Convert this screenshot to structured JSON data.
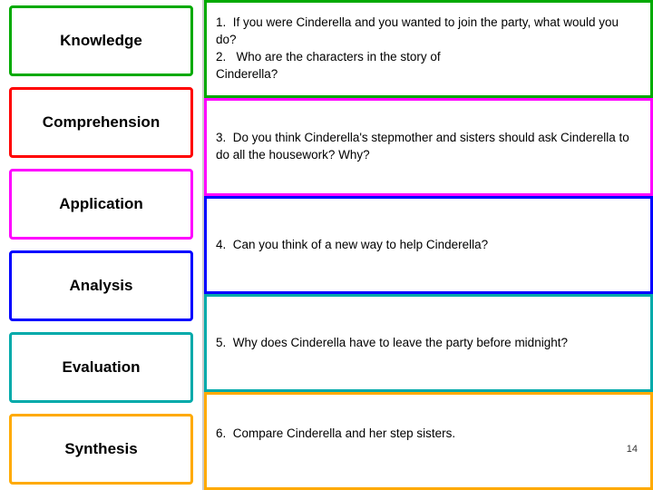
{
  "left": {
    "items": [
      {
        "label": "Knowledge",
        "class": "knowledge"
      },
      {
        "label": "Comprehension",
        "class": "comprehension"
      },
      {
        "label": "Application",
        "class": "application"
      },
      {
        "label": "Analysis",
        "class": "analysis"
      },
      {
        "label": "Evaluation",
        "class": "evaluation"
      },
      {
        "label": "Synthesis",
        "class": "synthesis"
      }
    ]
  },
  "right": {
    "rows": [
      {
        "class": "row1",
        "text": "1.  If you were Cinderella and you wanted to join the party, what would you do?\n2.   Who are the characters in the story of Cinderella?"
      },
      {
        "class": "row2",
        "text": "2.   Who are the characters in the story of Cinderella?"
      },
      {
        "class": "row3",
        "text": "3.  Do you think Cinderella's stepmother and sisters should ask Cinderella to do all the housework? Why?"
      },
      {
        "class": "row4",
        "text": "4.  Can you think of a new way to help Cinderella?"
      },
      {
        "class": "row5",
        "text": "5.  Why does Cinderella have to leave the party before midnight?"
      },
      {
        "class": "row6",
        "text": "6.  Compare Cinderella and her step sisters.",
        "page": "14"
      }
    ]
  }
}
